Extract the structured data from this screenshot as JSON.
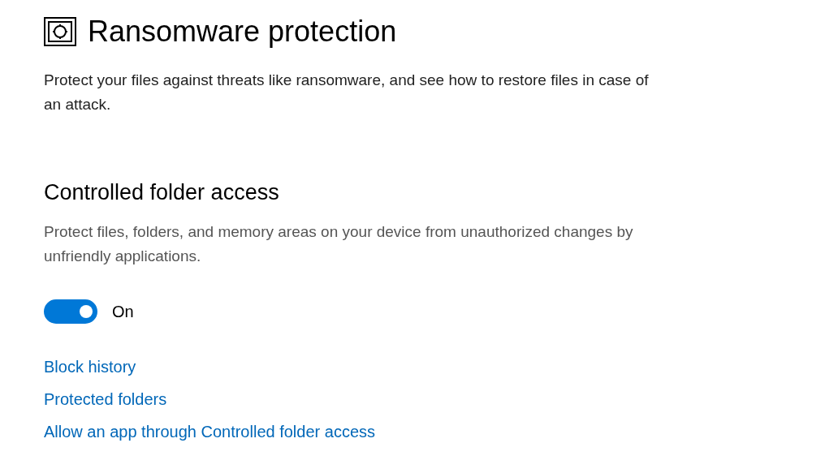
{
  "page": {
    "title": "Ransomware protection",
    "description": "Protect your files against threats like ransomware, and see how to restore files in case of an attack."
  },
  "section": {
    "title": "Controlled folder access",
    "description": "Protect files, folders, and memory areas on your device from unauthorized changes by unfriendly applications.",
    "toggle": {
      "on": true,
      "label": "On"
    },
    "links": [
      "Block history",
      "Protected folders",
      "Allow an app through Controlled folder access"
    ]
  }
}
